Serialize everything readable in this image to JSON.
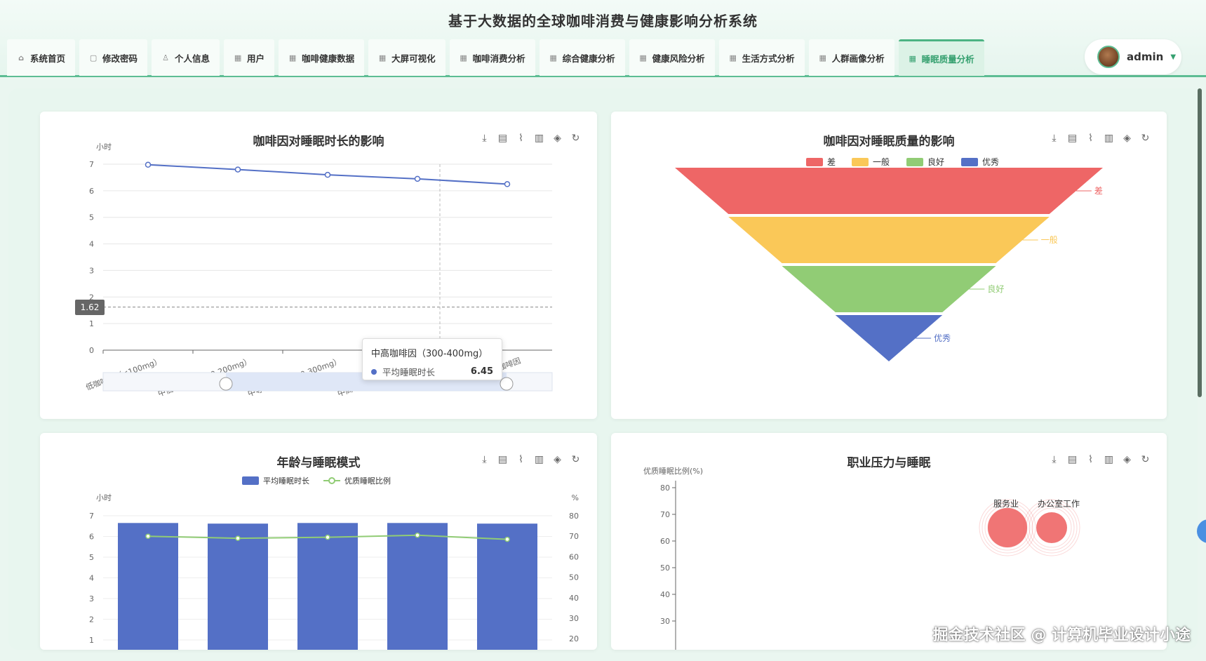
{
  "app": {
    "title": "基于大数据的全球咖啡消费与健康影响分析系统"
  },
  "nav": [
    {
      "label": "系统首页",
      "icon": "home-icon",
      "active": false
    },
    {
      "label": "修改密码",
      "icon": "lock-icon",
      "active": false
    },
    {
      "label": "个人信息",
      "icon": "user-icon",
      "active": false
    },
    {
      "label": "用户",
      "icon": "grid-icon",
      "active": false
    },
    {
      "label": "咖啡健康数据",
      "icon": "grid-icon",
      "active": false
    },
    {
      "label": "大屏可视化",
      "icon": "grid-icon",
      "active": false
    },
    {
      "label": "咖啡消费分析",
      "icon": "grid-icon",
      "active": false
    },
    {
      "label": "综合健康分析",
      "icon": "grid-icon",
      "active": false
    },
    {
      "label": "健康风险分析",
      "icon": "grid-icon",
      "active": false
    },
    {
      "label": "生活方式分析",
      "icon": "grid-icon",
      "active": false
    },
    {
      "label": "人群画像分析",
      "icon": "grid-icon",
      "active": false
    },
    {
      "label": "睡眠质量分析",
      "icon": "grid-icon",
      "active": true
    }
  ],
  "user": {
    "name": "admin"
  },
  "watermark": "掘金技术社区 @ 计算机毕业设计小途",
  "colors": {
    "accent": "#35a06f",
    "series_blue": "#5470c6",
    "series_green": "#91cc75",
    "series_yellow": "#fac858",
    "series_red": "#ee6666"
  },
  "chart_data": [
    {
      "type": "line",
      "title": "咖啡因对睡眠时长的影响",
      "ylabel": "小时",
      "ylim": [
        0,
        7
      ],
      "categories": [
        "低咖啡因（≤100mg）",
        "中低咖啡因（100-200mg）",
        "中等咖啡因（200-300mg）",
        "中高咖啡因（300-400mg）",
        "高咖啡因"
      ],
      "series": [
        {
          "name": "平均睡眠时长",
          "values": [
            6.98,
            6.8,
            6.6,
            6.45,
            6.25
          ]
        }
      ],
      "pointer_value": "1.62",
      "tooltip": {
        "title": "中高咖啡因（300-400mg）",
        "series": "平均睡眠时长",
        "value": "6.45"
      }
    },
    {
      "type": "funnel",
      "title": "咖啡因对睡眠质量的影响",
      "legend": [
        "差",
        "一般",
        "良好",
        "优秀"
      ],
      "categories": [
        "差",
        "一般",
        "良好",
        "优秀"
      ],
      "values": [
        100,
        75,
        50,
        25
      ],
      "colors": [
        "#ee6666",
        "#fac858",
        "#91cc75",
        "#5470c6"
      ]
    },
    {
      "type": "bar",
      "title": "年龄与睡眠模式",
      "ylabel": "小时",
      "y2label": "%",
      "ylim": [
        0,
        7
      ],
      "y2lim": [
        0,
        80
      ],
      "legend": [
        "平均睡眠时长",
        "优质睡眠比例"
      ],
      "series": [
        {
          "name": "平均睡眠时长",
          "type": "bar",
          "values": [
            6.65,
            6.62,
            6.65,
            6.65,
            6.62
          ]
        },
        {
          "name": "优质睡眠比例",
          "type": "line",
          "values": [
            70,
            69,
            69.5,
            70.5,
            68.5
          ]
        }
      ]
    },
    {
      "type": "scatter",
      "title": "职业压力与睡眠",
      "ylabel": "优质睡眠比例(%)",
      "ylim": [
        20,
        80
      ],
      "points": [
        {
          "label": "服务业",
          "y": 65
        },
        {
          "label": "办公室工作",
          "y": 65
        }
      ]
    }
  ]
}
